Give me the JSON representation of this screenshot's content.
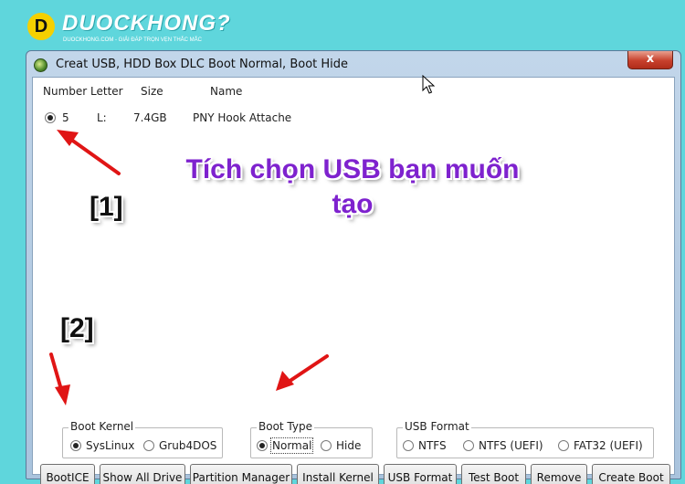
{
  "watermark": {
    "letter": "D",
    "name": "DUOCKHONG?",
    "tagline": "DUOCKHONG.COM - GIẢI ĐÁP TRỌN VẸN THẮC MẮC"
  },
  "window": {
    "title": "Creat USB, HDD Box DLC Boot Normal, Boot Hide",
    "close_glyph": "x"
  },
  "drive_list": {
    "columns": [
      "Number",
      "Letter",
      "Size",
      "Name"
    ],
    "rows": [
      {
        "selected": true,
        "number": "5",
        "letter": "L:",
        "size": "7.4GB",
        "name": "PNY Hook Attache"
      }
    ]
  },
  "annotations": {
    "instruction_line1": "Tích chọn USB bạn muốn",
    "instruction_line2": "tạo",
    "marker1": "[1]",
    "marker2": "[2]",
    "arrow_color": "#e01515"
  },
  "boot_kernel": {
    "legend": "Boot Kernel",
    "options": [
      {
        "label": "SysLinux",
        "selected": true
      },
      {
        "label": "Grub4DOS",
        "selected": false
      }
    ]
  },
  "boot_type": {
    "legend": "Boot Type",
    "options": [
      {
        "label": "Normal",
        "selected": true
      },
      {
        "label": "Hide",
        "selected": false
      }
    ]
  },
  "usb_format": {
    "legend": "USB Format",
    "options": [
      {
        "label": "NTFS",
        "selected": false
      },
      {
        "label": "NTFS (UEFI)",
        "selected": false
      },
      {
        "label": "FAT32 (UEFI)",
        "selected": false
      }
    ]
  },
  "buttons": {
    "bootice": "BootICE",
    "show_all_drive": "Show All Drive",
    "partition_manager": "Partition Manager",
    "install_kernel": "Install Kernel",
    "usb_format": "USB Format",
    "test_boot": "Test Boot",
    "remove": "Remove",
    "create_boot": "Create Boot"
  }
}
